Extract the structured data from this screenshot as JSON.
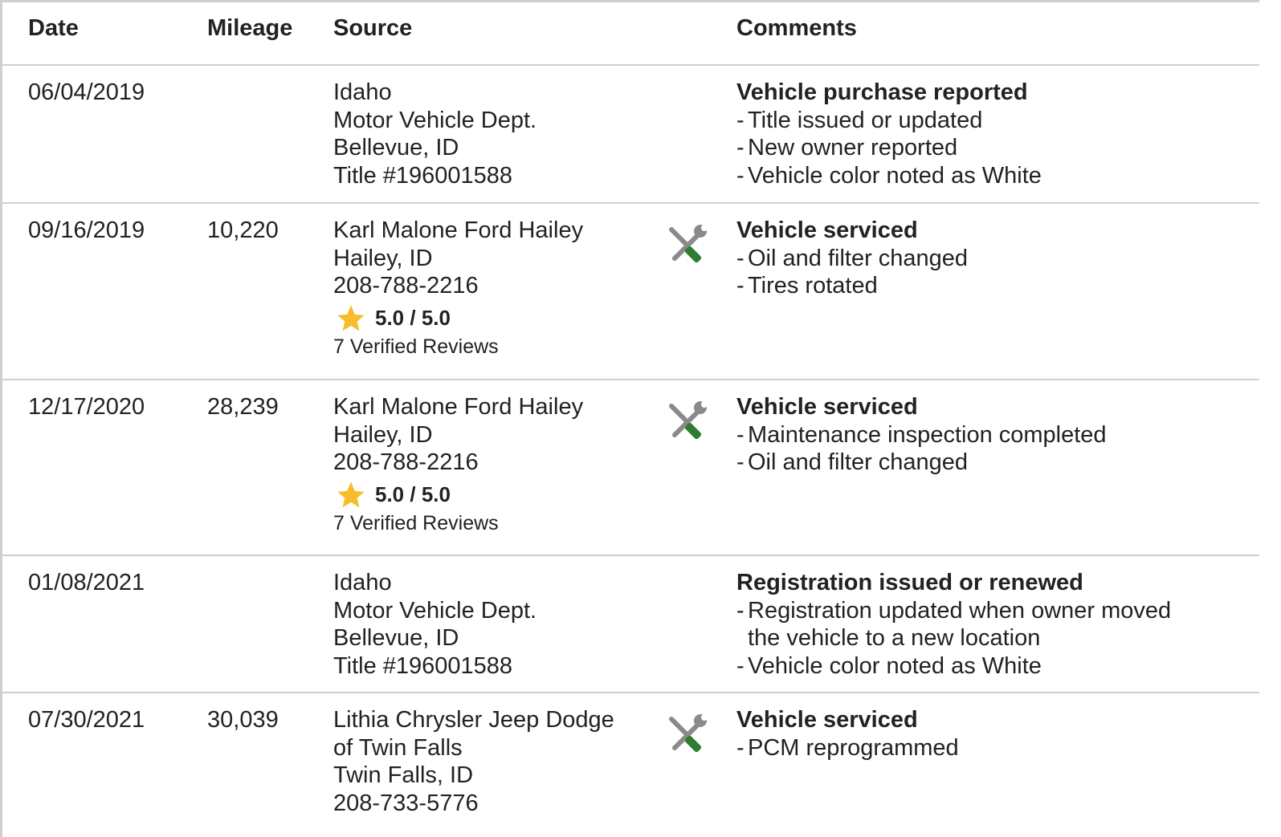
{
  "colors": {
    "border": "#cfcfcf",
    "text": "#222222",
    "star": "#f7bd2a",
    "tool_gray": "#8a8a8a",
    "tool_green": "#2e7d32"
  },
  "header": {
    "date": "Date",
    "mileage": "Mileage",
    "source": "Source",
    "comments": "Comments"
  },
  "rows": [
    {
      "date": "06/04/2019",
      "mileage": "",
      "source": [
        "Idaho",
        "Motor Vehicle Dept.",
        "Bellevue, ID",
        "Title #196001588"
      ],
      "icon": "",
      "comment_title": "Vehicle purchase reported",
      "comment_items": [
        "Title issued or updated",
        "New owner reported",
        "Vehicle color noted as White"
      ]
    },
    {
      "date": "09/16/2019",
      "mileage": "10,220",
      "source": [
        "Karl Malone Ford Hailey",
        "Hailey, ID",
        "208-788-2216"
      ],
      "rating": "5.0 / 5.0",
      "reviews": "7 Verified Reviews",
      "icon": "service-tools-icon",
      "comment_title": "Vehicle serviced",
      "comment_items": [
        "Oil and filter changed",
        "Tires rotated"
      ]
    },
    {
      "date": "12/17/2020",
      "mileage": "28,239",
      "source": [
        "Karl Malone Ford Hailey",
        "Hailey, ID",
        "208-788-2216"
      ],
      "rating": "5.0 / 5.0",
      "reviews": "7 Verified Reviews",
      "icon": "service-tools-icon",
      "comment_title": "Vehicle serviced",
      "comment_items": [
        "Maintenance inspection completed",
        "Oil and filter changed"
      ]
    },
    {
      "date": "01/08/2021",
      "mileage": "",
      "source": [
        "Idaho",
        "Motor Vehicle Dept.",
        "Bellevue, ID",
        "Title #196001588"
      ],
      "icon": "",
      "comment_title": "Registration issued or renewed",
      "comment_items": [
        "Registration updated when owner moved",
        "the vehicle to a new location",
        "Vehicle color noted as White"
      ]
    },
    {
      "date": "07/30/2021",
      "mileage": "30,039",
      "source": [
        "Lithia Chrysler Jeep Dodge",
        "of Twin Falls",
        "Twin Falls, ID",
        "208-733-5776"
      ],
      "icon": "service-tools-icon",
      "comment_title": "Vehicle serviced",
      "comment_items": [
        "PCM reprogrammed"
      ]
    }
  ]
}
